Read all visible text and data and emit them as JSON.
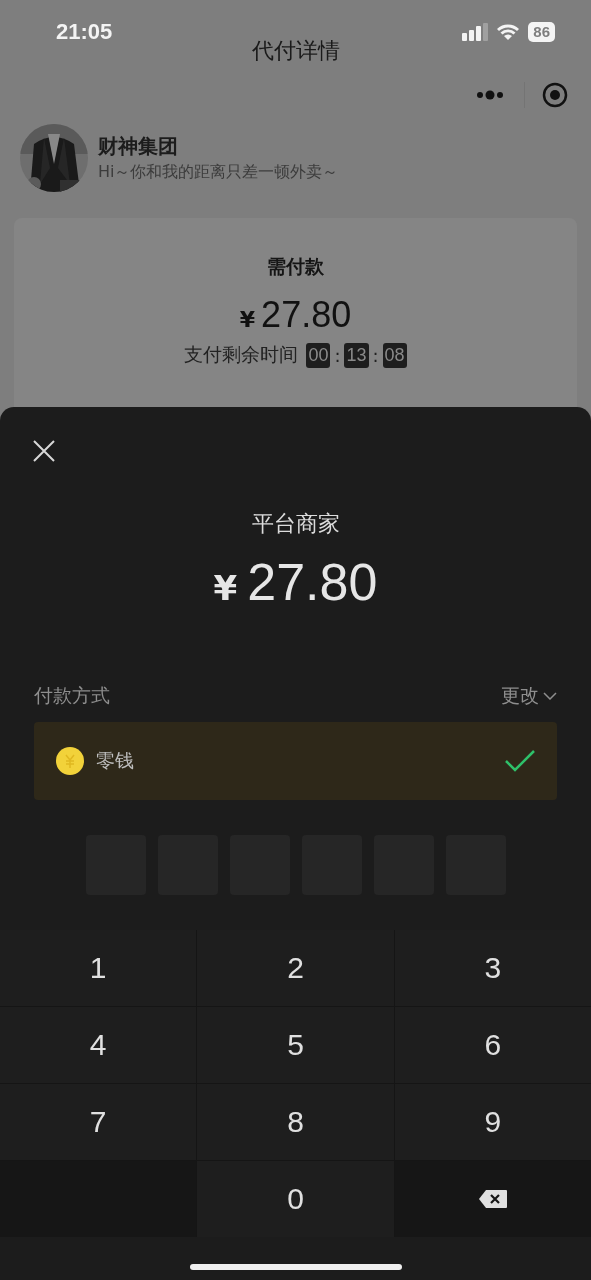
{
  "status_bar": {
    "time": "21:05",
    "battery": "86"
  },
  "nav": {
    "title": "代付详情"
  },
  "requester": {
    "name": "财神集团",
    "message": "Hi～你和我的距离只差一顿外卖～"
  },
  "order": {
    "label": "需付款",
    "currency": "¥",
    "amount": "27.80",
    "countdown_label": "支付剩余时间",
    "countdown": [
      {
        "text": "00",
        "kind": "digits"
      },
      {
        "text": ":",
        "kind": "separator"
      },
      {
        "text": "13",
        "kind": "digits"
      },
      {
        "text": ":",
        "kind": "separator"
      },
      {
        "text": "08",
        "kind": "digits"
      }
    ]
  },
  "sheet": {
    "payee": "平台商家",
    "currency": "¥",
    "amount": "27.80",
    "method_label": "付款方式",
    "change": "更改",
    "methods": [
      {
        "name": "零钱",
        "selected": true
      }
    ],
    "pin_boxes": [
      {
        "filled": false
      },
      {
        "filled": false
      },
      {
        "filled": false
      },
      {
        "filled": false
      },
      {
        "filled": false
      },
      {
        "filled": false
      }
    ],
    "keypad": [
      {
        "label": "1",
        "kind": "digit"
      },
      {
        "label": "2",
        "kind": "digit"
      },
      {
        "label": "3",
        "kind": "digit"
      },
      {
        "label": "4",
        "kind": "digit"
      },
      {
        "label": "5",
        "kind": "digit"
      },
      {
        "label": "6",
        "kind": "digit"
      },
      {
        "label": "7",
        "kind": "digit"
      },
      {
        "label": "8",
        "kind": "digit"
      },
      {
        "label": "9",
        "kind": "digit"
      },
      {
        "kind": "blank"
      },
      {
        "label": "0",
        "kind": "digit"
      },
      {
        "kind": "delete"
      }
    ]
  }
}
